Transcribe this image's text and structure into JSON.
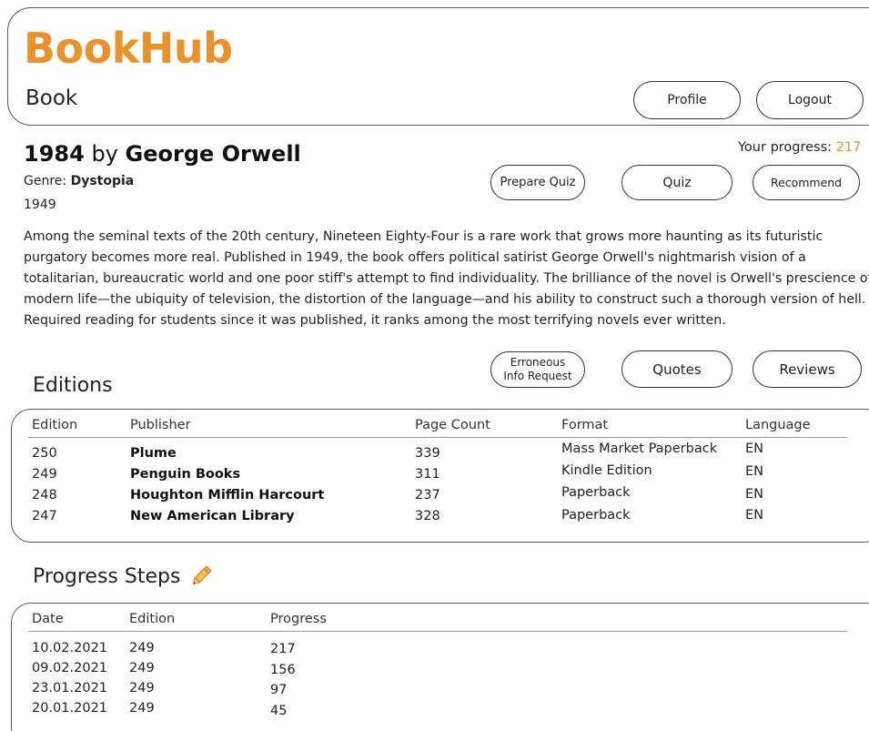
{
  "app": {
    "name": "BookHub",
    "page_label": "Book"
  },
  "header": {
    "profile_label": "Profile",
    "logout_label": "Logout"
  },
  "book": {
    "title": "1984",
    "by": "by",
    "author": "George Orwell",
    "genre_label": "Genre:",
    "genre": "Dystopia",
    "year": "1949",
    "description": "Among the seminal texts of the 20th century, Nineteen Eighty-Four is a rare work that grows more haunting as its futuristic purgatory becomes more real. Published in 1949, the book offers political satirist George Orwell's nightmarish vision of a totalitarian, bureaucratic world and one poor stiff's attempt to find individuality. The brilliance of the novel is Orwell's prescience of modern life—the ubiquity of television, the distortion of the language—and his ability to construct such a thorough version of hell. Required reading for students since it was published, it ranks among the most terrifying novels ever written."
  },
  "progress": {
    "label": "Your progress:",
    "value": "217"
  },
  "actions": {
    "prepare_quiz": "Prepare Quiz",
    "quiz": "Quiz",
    "recommend": "Recommend",
    "erroneous_line1": "Erroneous",
    "erroneous_line2": "Info Request",
    "quotes": "Quotes",
    "reviews": "Reviews"
  },
  "editions": {
    "title": "Editions",
    "columns": [
      "Edition",
      "Publisher",
      "Page Count",
      "Format",
      "Language"
    ],
    "rows": [
      [
        "250",
        "Plume",
        "339",
        "Mass Market Paperback",
        "EN"
      ],
      [
        "249",
        "Penguin Books",
        "311",
        "Kindle Edition",
        "EN"
      ],
      [
        "248",
        "Houghton Mifflin Harcourt",
        "237",
        "Paperback",
        "EN"
      ],
      [
        "247",
        "New American Library",
        "328",
        "Paperback",
        "EN"
      ]
    ]
  },
  "progress_steps": {
    "title": "Progress Steps",
    "edit_icon": "pencil-icon",
    "columns": [
      "Date",
      "Edition",
      "Progress"
    ],
    "rows": [
      [
        "10.02.2021",
        "249",
        "217"
      ],
      [
        "09.02.2021",
        "249",
        "156"
      ],
      [
        "23.01.2021",
        "249",
        "97"
      ],
      [
        "20.01.2021",
        "249",
        "45"
      ]
    ]
  },
  "colors": {
    "accent": "#e8922e",
    "scroll_accent": "#f2c79a"
  }
}
